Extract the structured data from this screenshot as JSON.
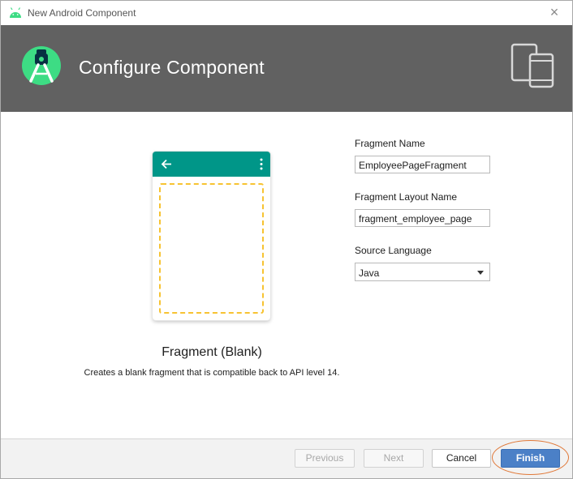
{
  "window": {
    "title": "New Android Component",
    "close_glyph": "×"
  },
  "header": {
    "title": "Configure Component",
    "logo_icon": "android-studio-icon",
    "devices_icon": "devices-icon",
    "background_color": "#616161"
  },
  "template": {
    "name": "Fragment (Blank)",
    "description": "Creates a blank fragment that is compatible back to API level 14.",
    "appbar_color": "#009688",
    "placeholder_border_color": "#f7c332"
  },
  "form": {
    "fragment_name": {
      "label": "Fragment Name",
      "value": "EmployeePageFragment"
    },
    "layout_name": {
      "label": "Fragment Layout Name",
      "value": "fragment_employee_page"
    },
    "source_language": {
      "label": "Source Language",
      "selected": "Java"
    }
  },
  "footer": {
    "previous_label": "Previous",
    "next_label": "Next",
    "cancel_label": "Cancel",
    "finish_label": "Finish",
    "accent_color": "#4b80c7"
  }
}
